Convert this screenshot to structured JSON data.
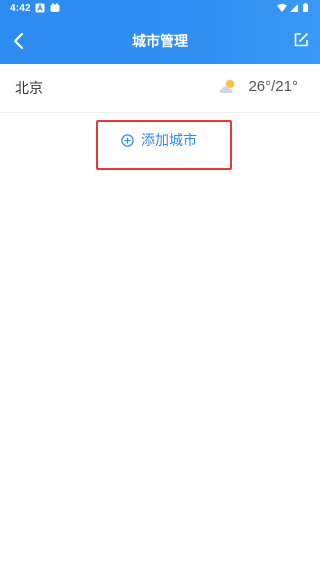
{
  "status_bar": {
    "time": "4:42"
  },
  "app_bar": {
    "title": "城市管理"
  },
  "cities": [
    {
      "name": "北京",
      "weather_icon": "partly-cloudy-icon",
      "temperature": "26°/21°"
    }
  ],
  "add_city": {
    "label": "添加城市",
    "icon": "plus-circle-icon"
  },
  "colors": {
    "accent": "#2d8cf0",
    "highlight_border": "#e53935"
  }
}
